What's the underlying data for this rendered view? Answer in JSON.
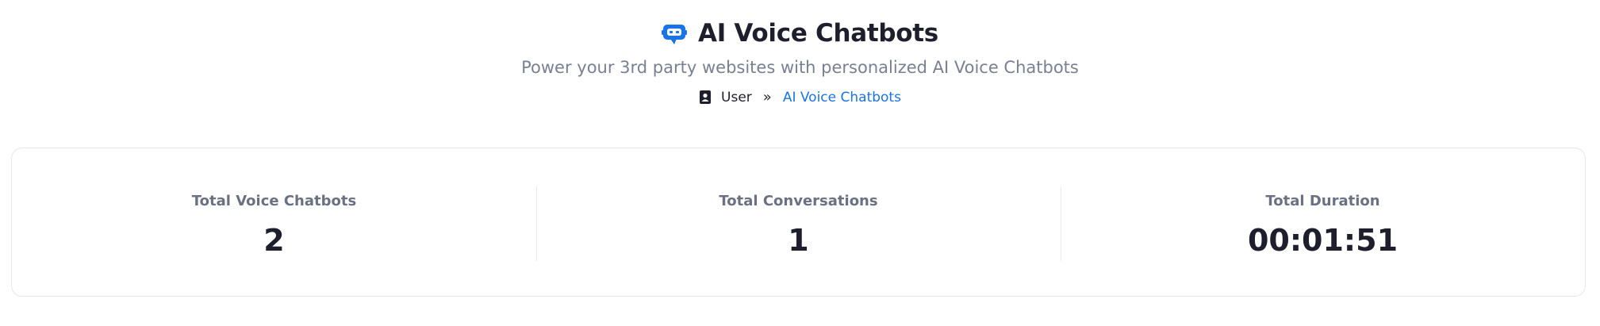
{
  "page": {
    "title": "AI Voice Chatbots",
    "title_icon": "chatbot-icon",
    "subtitle": "Power your 3rd party websites with personalized AI Voice Chatbots"
  },
  "breadcrumb": {
    "user_icon": "user-badge-icon",
    "user_label": "User",
    "separator": "»",
    "current": "AI Voice Chatbots"
  },
  "stats": [
    {
      "label": "Total Voice Chatbots",
      "value": "2"
    },
    {
      "label": "Total Conversations",
      "value": "1"
    },
    {
      "label": "Total Duration",
      "value": "00:01:51"
    }
  ],
  "colors": {
    "accent": "#1a73e8",
    "text_dark": "#1e1e2d",
    "text_muted": "#7a7f93",
    "border": "#e4e6ef"
  }
}
